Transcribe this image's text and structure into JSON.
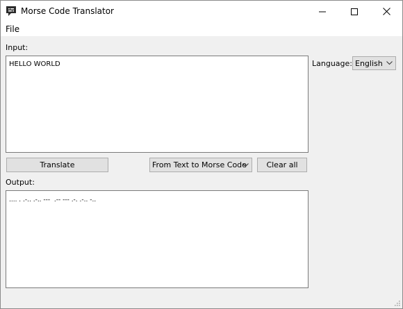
{
  "window": {
    "title": "Morse Code Translator"
  },
  "menu": {
    "file": "File"
  },
  "input": {
    "label": "Input:",
    "value": "HELLO WORLD"
  },
  "language": {
    "label": "Language:",
    "selected": "English"
  },
  "actions": {
    "translate": "Translate",
    "direction": "From Text to Morse Code",
    "clear_all": "Clear all"
  },
  "output": {
    "label": "Output:",
    "value": ".... . .-.. .-.. ---  .-- --- .-. .-.. -.."
  }
}
